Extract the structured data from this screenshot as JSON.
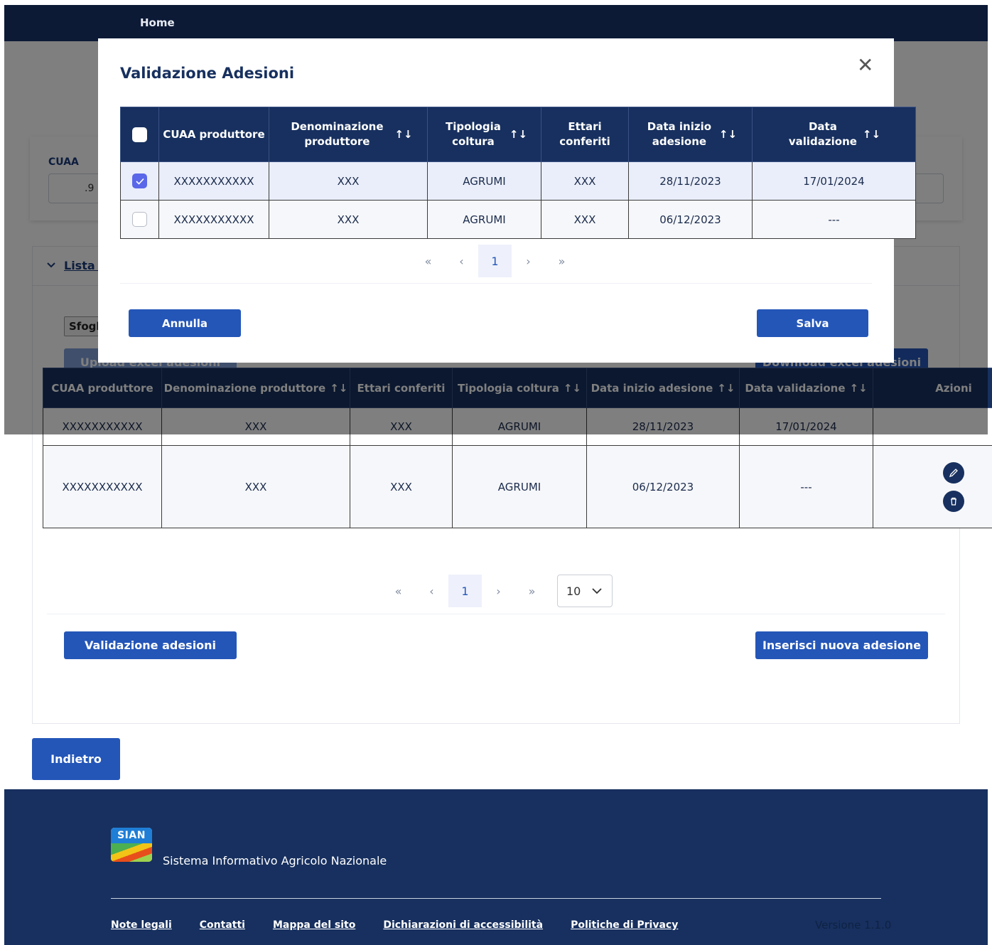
{
  "header": {
    "home": "Home"
  },
  "filter": {
    "cuaa_label": "CUAA",
    "cuaa_value": ".9"
  },
  "list": {
    "section_title": "Lista A",
    "file_button": "Sfogli",
    "upload_button": "Upload excel adesioni",
    "download_button": "Download excel adesioni",
    "columns": [
      "CUAA produttore",
      "Denominazione produttore",
      "Ettari conferiti",
      "Tipologia coltura",
      "Data inizio adesione",
      "Data validazione",
      "Azioni"
    ],
    "rows": [
      {
        "cuaa": "XXXXXXXXXXX",
        "denominazione": "XXX",
        "ettari": "XXX",
        "tipologia": "AGRUMI",
        "data_inizio": "28/11/2023",
        "data_validazione": "17/01/2024"
      },
      {
        "cuaa": "XXXXXXXXXXX",
        "denominazione": "XXX",
        "ettari": "XXX",
        "tipologia": "AGRUMI",
        "data_inizio": "06/12/2023",
        "data_validazione": "---"
      }
    ],
    "pagination": {
      "first": "«",
      "prev": "‹",
      "page": "1",
      "next": "›",
      "last": "»",
      "page_size": "10"
    },
    "validate_button": "Validazione adesioni",
    "insert_button": "Inserisci nuova adesione"
  },
  "back_button": "Indietro",
  "modal": {
    "title": "Validazione Adesioni",
    "close": "✕",
    "columns": [
      "CUAA produttore",
      "Denominazione produttore",
      "Tipologia coltura",
      "Ettari conferiti",
      "Data inizio adesione",
      "Data validazione"
    ],
    "rows": [
      {
        "checked": true,
        "cuaa": "XXXXXXXXXXX",
        "denominazione": "XXX",
        "tipologia": "AGRUMI",
        "ettari": "XXX",
        "data_inizio": "28/11/2023",
        "data_validazione": "17/01/2024"
      },
      {
        "checked": false,
        "cuaa": "XXXXXXXXXXX",
        "denominazione": "XXX",
        "tipologia": "AGRUMI",
        "ettari": "XXX",
        "data_inizio": "06/12/2023",
        "data_validazione": "---"
      }
    ],
    "pagination": {
      "first": "«",
      "prev": "‹",
      "page": "1",
      "next": "›",
      "last": "»"
    },
    "cancel_button": "Annulla",
    "save_button": "Salva"
  },
  "footer": {
    "logo_text": "SIAN",
    "org_name": "Sistema Informativo Agricolo Nazionale",
    "links": [
      "Note legali",
      "Contatti",
      "Mappa del sito",
      "Dichiarazioni di accessibilità",
      "Politiche di Privacy"
    ],
    "version": "Versione 1.1.0"
  },
  "icons": {
    "sort": "sort-arrows-icon",
    "edit": "pencil-icon",
    "delete": "trash-icon",
    "chevron": "chevron-down-icon",
    "close": "close-icon"
  },
  "colors": {
    "primary": "#2456b8",
    "header_dark": "#17305f",
    "topbar": "#0c1a36"
  }
}
